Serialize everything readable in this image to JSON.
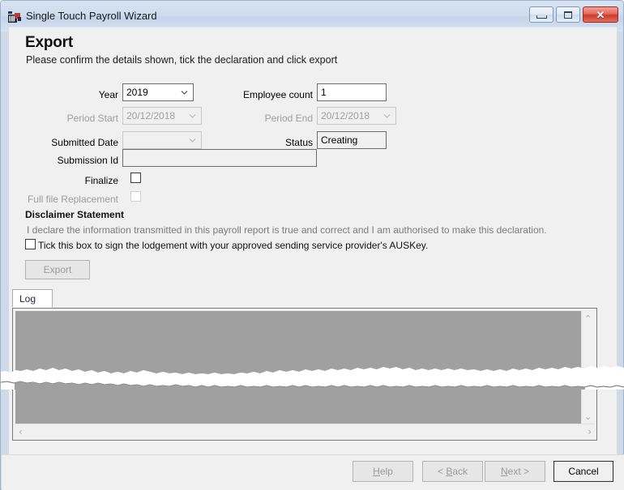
{
  "window": {
    "title": "Single Touch Payroll Wizard",
    "icon": "app-icon",
    "caption_buttons": [
      {
        "name": "minimize",
        "glyph": "minimize-icon"
      },
      {
        "name": "maximize",
        "glyph": "maximize-icon"
      },
      {
        "name": "close",
        "glyph": "close-icon",
        "label": "✕",
        "color": "#d1392b"
      }
    ]
  },
  "page": {
    "title": "Export",
    "subtitle": "Please confirm the details shown, tick the declaration and click export"
  },
  "form": {
    "year": {
      "label": "Year",
      "value": "2019",
      "disabled": false
    },
    "employee_count": {
      "label": "Employee count",
      "value": "1",
      "disabled": false
    },
    "period_start": {
      "label": "Period Start",
      "value": "20/12/2018",
      "disabled": true
    },
    "period_end": {
      "label": "Period End",
      "value": "20/12/2018",
      "disabled": true
    },
    "submitted_date": {
      "label": "Submitted Date",
      "value": "",
      "disabled": true
    },
    "status": {
      "label": "Status",
      "value": "Creating",
      "disabled": false
    },
    "submission_id": {
      "label": "Submission Id",
      "value": "",
      "disabled": false
    },
    "finalize": {
      "label": "Finalize",
      "checked": false,
      "disabled": false
    },
    "full_file_replacement": {
      "label": "Full file Replacement",
      "checked": false,
      "disabled": true
    }
  },
  "disclaimer": {
    "heading": "Disclaimer Statement",
    "declaration": "I declare the information transmitted in this payroll report is true and correct and I am authorised to make this declaration.",
    "tick_label": "Tick this box to sign the lodgement with your approved sending service provider's AUSKey.",
    "tick_checked": false
  },
  "export_button": {
    "label": "Export",
    "enabled": false
  },
  "tabs": {
    "items": [
      {
        "label": "Log",
        "selected": true
      }
    ]
  },
  "log": {
    "content": "",
    "vertical_scroll_up": "⌃",
    "vertical_scroll_down": "⌄",
    "horizontal_scroll_left": "‹",
    "horizontal_scroll_right": "›"
  },
  "footer_buttons": [
    {
      "name": "help",
      "label": "Help",
      "mnemonic": "H",
      "enabled": false
    },
    {
      "name": "back",
      "label": "< Back",
      "mnemonic": "B",
      "enabled": false
    },
    {
      "name": "next",
      "label": "Next >",
      "mnemonic": "N",
      "enabled": false
    },
    {
      "name": "cancel",
      "label": "Cancel",
      "mnemonic": "",
      "enabled": true
    }
  ],
  "colors": {
    "window_frame": "#cfd9e8",
    "client_bg": "#f0f0f0",
    "log_bg": "#a0a0a0",
    "close_button": "#d1392b",
    "disabled_text": "#9d9d9d"
  }
}
